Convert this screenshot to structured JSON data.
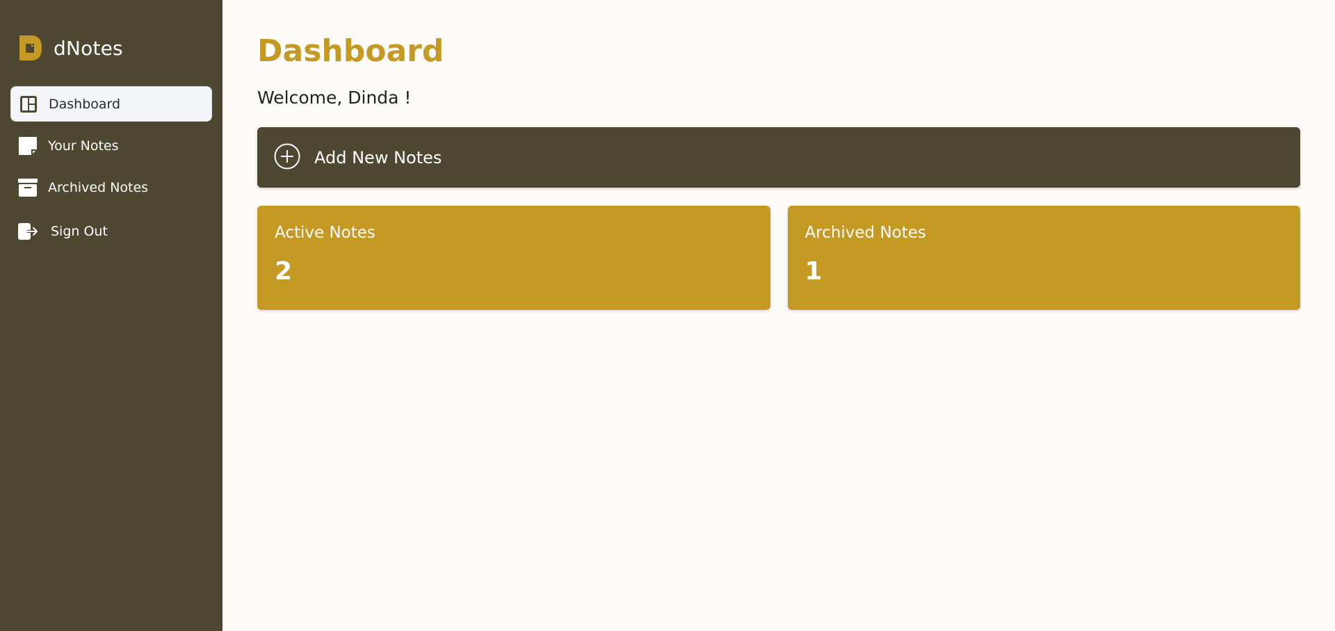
{
  "app": {
    "name": "dNotes",
    "logo_icon": "notes-logo-icon",
    "accent_color": "#c49a24",
    "sidebar_color": "#4e4732"
  },
  "sidebar": {
    "items": [
      {
        "label": "Dashboard",
        "icon": "dashboard-icon",
        "active": true
      },
      {
        "label": "Your Notes",
        "icon": "note-icon",
        "active": false
      },
      {
        "label": "Archived Notes",
        "icon": "archive-icon",
        "active": false
      },
      {
        "label": "Sign Out",
        "icon": "sign-out-icon",
        "active": false
      }
    ]
  },
  "main": {
    "title": "Dashboard",
    "welcome": "Welcome, Dinda !",
    "add_button": {
      "label": "Add New Notes",
      "icon": "plus-circle-icon"
    },
    "cards": [
      {
        "title": "Active Notes",
        "value": "2"
      },
      {
        "title": "Archived Notes",
        "value": "1"
      }
    ]
  }
}
